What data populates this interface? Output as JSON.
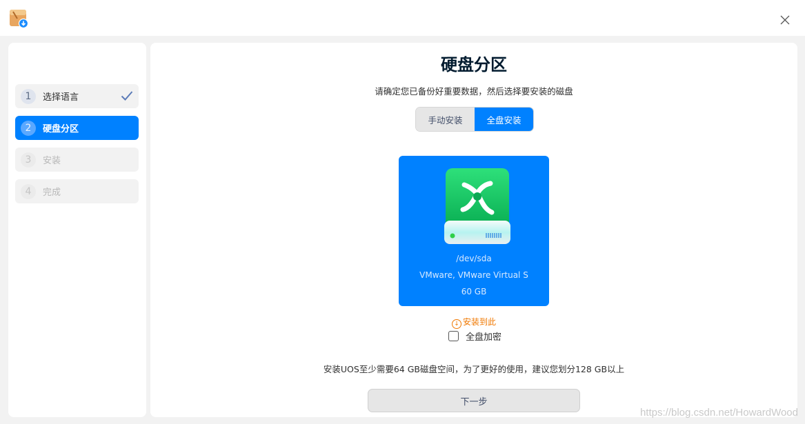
{
  "titlebar": {
    "app_icon": "installer-package-icon",
    "close_icon": "close-icon"
  },
  "sidebar": {
    "steps": [
      {
        "num": "1",
        "label": "选择语言",
        "state": "done"
      },
      {
        "num": "2",
        "label": "硬盘分区",
        "state": "active"
      },
      {
        "num": "3",
        "label": "安装",
        "state": "pending"
      },
      {
        "num": "4",
        "label": "完成",
        "state": "pending"
      }
    ]
  },
  "main": {
    "title": "硬盘分区",
    "subtitle": "请确定您已备份好重要数据，然后选择要安装的磁盘",
    "mode_tabs": [
      {
        "label": "手动安装",
        "selected": false
      },
      {
        "label": "全盘安装",
        "selected": true
      }
    ],
    "disk": {
      "path": "/dev/sda",
      "model": "VMware, VMware Virtual S",
      "size": "60 GB",
      "selected": true,
      "icon": "hard-disk-icon"
    },
    "install_here": "安装到此",
    "encrypt_label": "全盘加密",
    "encrypt_checked": false,
    "note": "安装UOS至少需要64 GB磁盘空间，为了更好的使用，建议您划分128 GB以上",
    "next_label": "下一步"
  },
  "watermark": "https://blog.csdn.net/HowardWood",
  "colors": {
    "accent": "#0081ff",
    "warning": "#f07800"
  }
}
